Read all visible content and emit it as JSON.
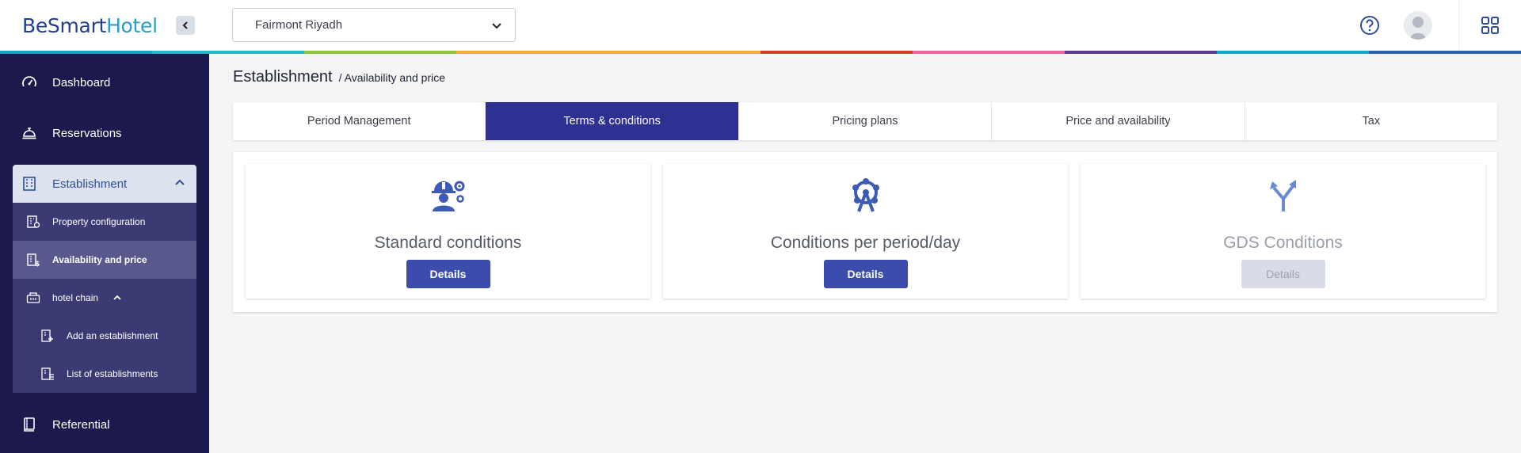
{
  "header": {
    "logo_part1": "BeSmart",
    "logo_part2": "Hotel",
    "hotel_select_value": "Fairmont Riyadh"
  },
  "rainbow_colors": [
    "#1ba3c6",
    "#2ab5c9",
    "#8cc63f",
    "#f2b134",
    "#f2b134",
    "#d63a2b",
    "#e8669c",
    "#5b3a8e",
    "#1ba3c6",
    "#2f5fa8"
  ],
  "sidebar": {
    "items": [
      {
        "label": "Dashboard",
        "icon": "speedometer-icon"
      },
      {
        "label": "Reservations",
        "icon": "concierge-bell-icon"
      },
      {
        "label": "Establishment",
        "icon": "building-icon"
      },
      {
        "label": "Referential",
        "icon": "book-icon"
      }
    ],
    "submenu": [
      {
        "label": "Property configuration",
        "icon": "building-settings-icon"
      },
      {
        "label": "Availability and price",
        "icon": "building-price-icon"
      },
      {
        "label": "hotel chain",
        "icon": "hotel-chain-icon"
      },
      {
        "label": "Add an establishment",
        "icon": "building-add-icon"
      },
      {
        "label": "List of establishments",
        "icon": "building-list-icon"
      }
    ]
  },
  "breadcrumb": {
    "title": "Establishment",
    "sub": "/ Availability and price"
  },
  "tabs": [
    {
      "label": "Period Management"
    },
    {
      "label": "Terms & conditions"
    },
    {
      "label": "Pricing plans"
    },
    {
      "label": "Price and availability"
    },
    {
      "label": "Tax"
    }
  ],
  "active_tab": "Terms & conditions",
  "cards": [
    {
      "title": "Standard conditions",
      "button": "Details",
      "icon": "worker-gear-icon",
      "enabled": true
    },
    {
      "title": "Conditions per period/day",
      "button": "Details",
      "icon": "ferris-wheel-icon",
      "enabled": true
    },
    {
      "title": "GDS Conditions",
      "button": "Details",
      "icon": "split-arrows-icon",
      "enabled": false
    }
  ],
  "colors": {
    "sidebar_bg": "#1c1a4d",
    "submenu_bg": "#3b3a72",
    "tab_active": "#2e3192",
    "button": "#3c4cad",
    "accent_logo": "#243f8c"
  }
}
